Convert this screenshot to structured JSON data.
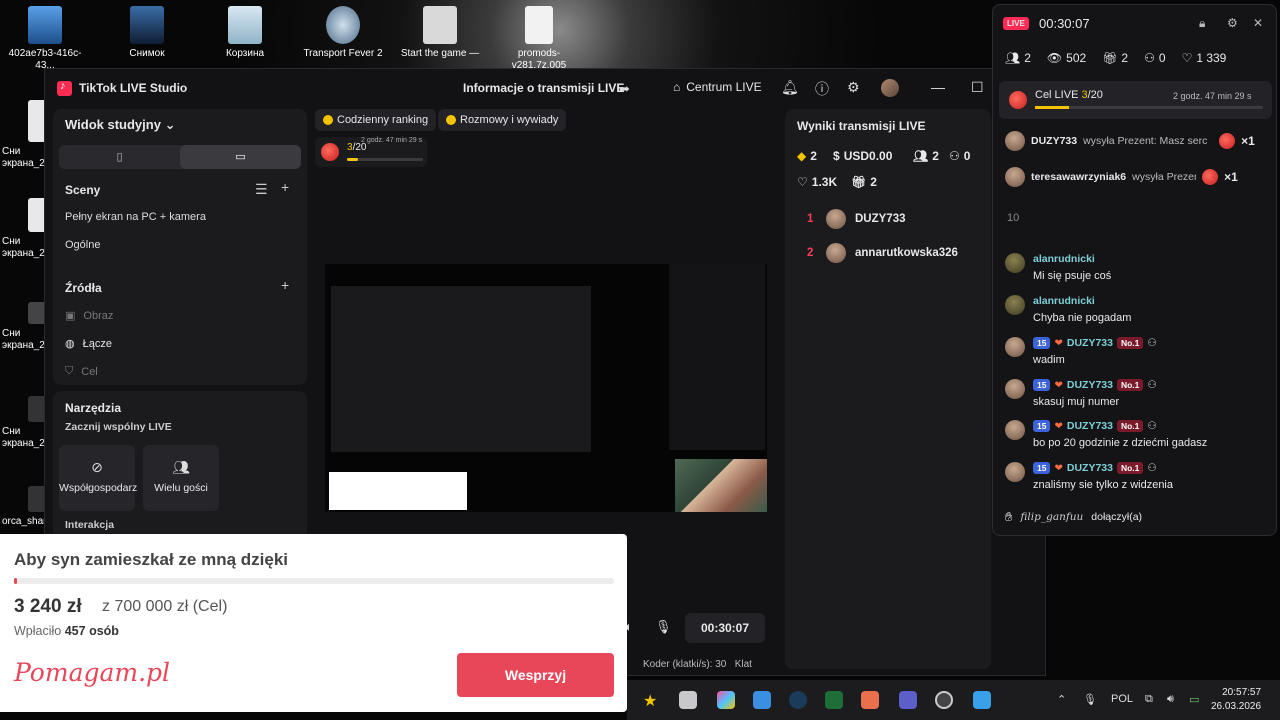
{
  "desktop": {
    "icons": [
      {
        "label": "402ae7b3-416c-43..."
      },
      {
        "label": "Снимок"
      },
      {
        "label": "Корзина"
      },
      {
        "label": "Transport Fever 2"
      },
      {
        "label": "Start the game —"
      },
      {
        "label": "promods-v281.7z.005"
      }
    ],
    "side_icons": [
      {
        "label": "Сни экрана_2"
      },
      {
        "label": "Сни экрана_2"
      },
      {
        "label": "Сни экрана_2"
      },
      {
        "label": "Сни экрана_2"
      },
      {
        "label": "orca_shar"
      }
    ]
  },
  "studio": {
    "app_name": "TikTok LIVE Studio",
    "title": "Informacje o transmisji LIVE",
    "centrum": "Centrum LIVE",
    "view_label": "Widok studyjny",
    "scenes": {
      "heading": "Sceny",
      "items": [
        "Pełny ekran na PC + kamera",
        "Ogólne"
      ]
    },
    "sources": {
      "heading": "Źródła",
      "items": [
        "Obraz",
        "Łącze",
        "Cel"
      ]
    },
    "tools": {
      "heading": "Narzędzia",
      "subheading": "Zacznij wspólny LIVE",
      "buttons": [
        "Współgospodarz",
        "Wielu gości"
      ],
      "interaction": "Interakcja"
    },
    "chips": [
      "Codzienny ranking",
      "Rozmowy i wywiady"
    ],
    "goal_mini": {
      "current": "3",
      "total": "/20",
      "time": "2 godz. 47 min 29 s"
    },
    "timer": "00:30:07",
    "encoder_label": "Koder (klatki/s):",
    "encoder_value": "30",
    "encoder_trailing": "Klat",
    "results": {
      "title": "Wyniki transmisji LIVE",
      "diamonds": "2",
      "usd": "USD0.00",
      "followers": "2",
      "shares": "0",
      "likes": "1.3K",
      "gifts": "2",
      "ranking": [
        {
          "rank": "1",
          "name": "DUZY733"
        },
        {
          "rank": "2",
          "name": "annarutkowska326"
        }
      ]
    }
  },
  "overlay": {
    "live_badge": "LIVE",
    "timer": "00:30:07",
    "stats": {
      "users": "2",
      "views": "502",
      "gifts": "2",
      "shares": "0",
      "likes": "1 339"
    },
    "goal": {
      "label": "Cel LIVE",
      "current": "3",
      "total": "/20",
      "time": "2 godz. 47 min 29 s"
    },
    "gift_events": [
      {
        "name": "DUZY733",
        "text": "wysyła Prezent: Masz serc",
        "count": "×1"
      },
      {
        "name": "teresawawrzyniak6",
        "text": "wysyła Prezent: M",
        "count": "×1"
      }
    ],
    "gift_counter": "10",
    "chat": [
      {
        "name": "alanrudnicki",
        "msg": "Mi się psuje coś",
        "badges": false
      },
      {
        "name": "alanrudnicki",
        "msg": "Chyba nie pogadam",
        "badges": false
      },
      {
        "name": "DUZY733",
        "msg": "wadim",
        "badges": true
      },
      {
        "name": "DUZY733",
        "msg": "skasuj muj numer",
        "badges": true
      },
      {
        "name": "DUZY733",
        "msg": "bo po 20 godzinie z dziećmi gadasz",
        "badges": true
      },
      {
        "name": "DUZY733",
        "msg": "znaliśmy sie tylko z widzenia",
        "badges": true
      }
    ],
    "badge_level": "15",
    "badge_rank": "No.1",
    "join": {
      "name": "filip_ganfuu",
      "text": "dołączył(a)"
    }
  },
  "pomagam": {
    "title": "Aby syn zamieszkał ze mną dzięki",
    "amount": "3 240 zł",
    "goal_text": "z 700 000 zł (Cel)",
    "paid_label": "Wpłaciło",
    "paid_count": "457 osób",
    "logo": "Pomagam.pl",
    "button": "Wesprzyj",
    "progress": 0.0046
  },
  "taskbar": {
    "language": "POL",
    "time": "20:57:57",
    "date": "26.03.2026"
  },
  "colors": {
    "accent": "#fe2c55",
    "goal": "#f5c400",
    "pomagam": "#e8475a",
    "chat_name": "#7ecfd8"
  }
}
